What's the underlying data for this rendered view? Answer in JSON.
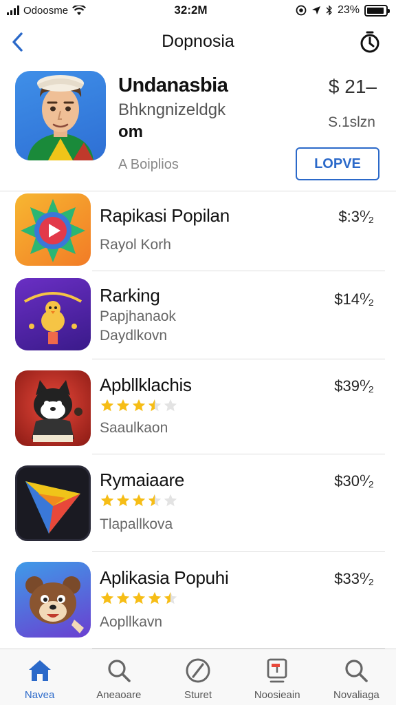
{
  "status_bar": {
    "carrier": "Odoosme",
    "time": "32:2M",
    "battery": "23%"
  },
  "nav": {
    "title": "Dopnosia"
  },
  "featured": {
    "name": "Undanasbia",
    "subtitle": "Bhkngnizeldgk",
    "line3": "om",
    "developer": "A Boiplios",
    "price": "$ 21–",
    "price_sub": "S.1slzn",
    "get_label": "LOPVE"
  },
  "apps": [
    {
      "name": "Rapikasi Popilan",
      "subtitle": "Rayol Korh",
      "price": "$:3⁰⁄₂"
    },
    {
      "name": "Rarking",
      "subtitle": "Papjhanaok",
      "developer": "Daydlkovn",
      "price": "$14⁰⁄₂"
    },
    {
      "name": "Apbllklachis",
      "rating": 3.5,
      "developer": "Saaulkaon",
      "price": "$39⁰⁄₂"
    },
    {
      "name": "Rymaiaare",
      "rating": 3.5,
      "developer": "Tlapallkova",
      "price": "$30⁰⁄₂"
    },
    {
      "name": "Aplikasia Popuhi",
      "rating": 4.5,
      "developer": "Aopllkavn",
      "price": "$33⁰⁄₂"
    }
  ],
  "tabs": [
    {
      "label": "Navea",
      "icon": "home-icon",
      "active": true
    },
    {
      "label": "Aneaoare",
      "icon": "search-icon"
    },
    {
      "label": "Sturet",
      "icon": "compass-icon"
    },
    {
      "label": "Noosieain",
      "icon": "updates-icon"
    },
    {
      "label": "Novaliaga",
      "icon": "search-icon"
    }
  ],
  "colors": {
    "accent": "#2b69c9",
    "star": "#f6bd16",
    "star_empty": "#e3e3e3"
  }
}
